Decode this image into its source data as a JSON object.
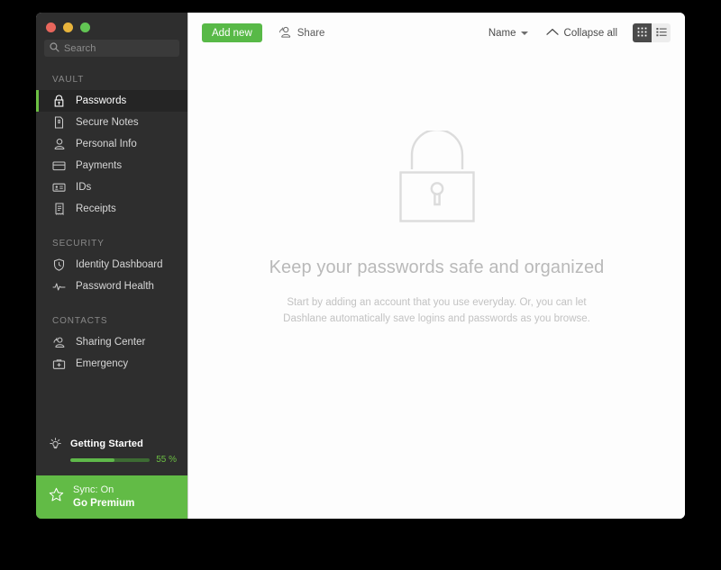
{
  "window": {
    "traffic_lights": [
      "close",
      "minimize",
      "zoom"
    ]
  },
  "sidebar": {
    "search": {
      "placeholder": "Search",
      "value": ""
    },
    "sections": [
      {
        "label": "VAULT",
        "items": [
          {
            "label": "Passwords",
            "icon": "lock-icon",
            "active": true
          },
          {
            "label": "Secure Notes",
            "icon": "note-icon",
            "active": false
          },
          {
            "label": "Personal Info",
            "icon": "person-icon",
            "active": false
          },
          {
            "label": "Payments",
            "icon": "credit-card-icon",
            "active": false
          },
          {
            "label": "IDs",
            "icon": "id-card-icon",
            "active": false
          },
          {
            "label": "Receipts",
            "icon": "receipt-icon",
            "active": false
          }
        ]
      },
      {
        "label": "SECURITY",
        "items": [
          {
            "label": "Identity Dashboard",
            "icon": "shield-icon",
            "active": false
          },
          {
            "label": "Password Health",
            "icon": "pulse-icon",
            "active": false
          }
        ]
      },
      {
        "label": "CONTACTS",
        "items": [
          {
            "label": "Sharing Center",
            "icon": "share-people-icon",
            "active": false
          },
          {
            "label": "Emergency",
            "icon": "first-aid-kit-icon",
            "active": false
          }
        ]
      }
    ],
    "getting_started": {
      "title": "Getting Started",
      "icon": "lightbulb-icon",
      "progress_percent": 55,
      "progress_label": "55 %",
      "track_color": "#3d6b33",
      "fill_color": "#5fb84a"
    },
    "footer": {
      "sync_label": "Sync: On",
      "premium_label": "Go Premium",
      "icon": "star-icon",
      "background_color": "#62bb46"
    },
    "accent_color": "#6cbf43",
    "background_color": "#2e2e2e"
  },
  "toolbar": {
    "add_new_label": "Add new",
    "add_new_color": "#58b947",
    "share_label": "Share",
    "share_icon": "share-person-icon",
    "sort_label": "Name",
    "sort_icon": "chevron-down-icon",
    "collapse_label": "Collapse all",
    "collapse_icon": "chevron-up-icon",
    "view_grid_icon": "grid-view-icon",
    "view_list_icon": "list-view-icon",
    "view_selected": "grid"
  },
  "empty_state": {
    "illustration": "padlock-icon",
    "title": "Keep your passwords safe and organized",
    "subtitle_line1": "Start by adding an account that you use everyday. Or, you can let",
    "subtitle_line2": "Dashlane automatically save logins and passwords as you browse."
  }
}
